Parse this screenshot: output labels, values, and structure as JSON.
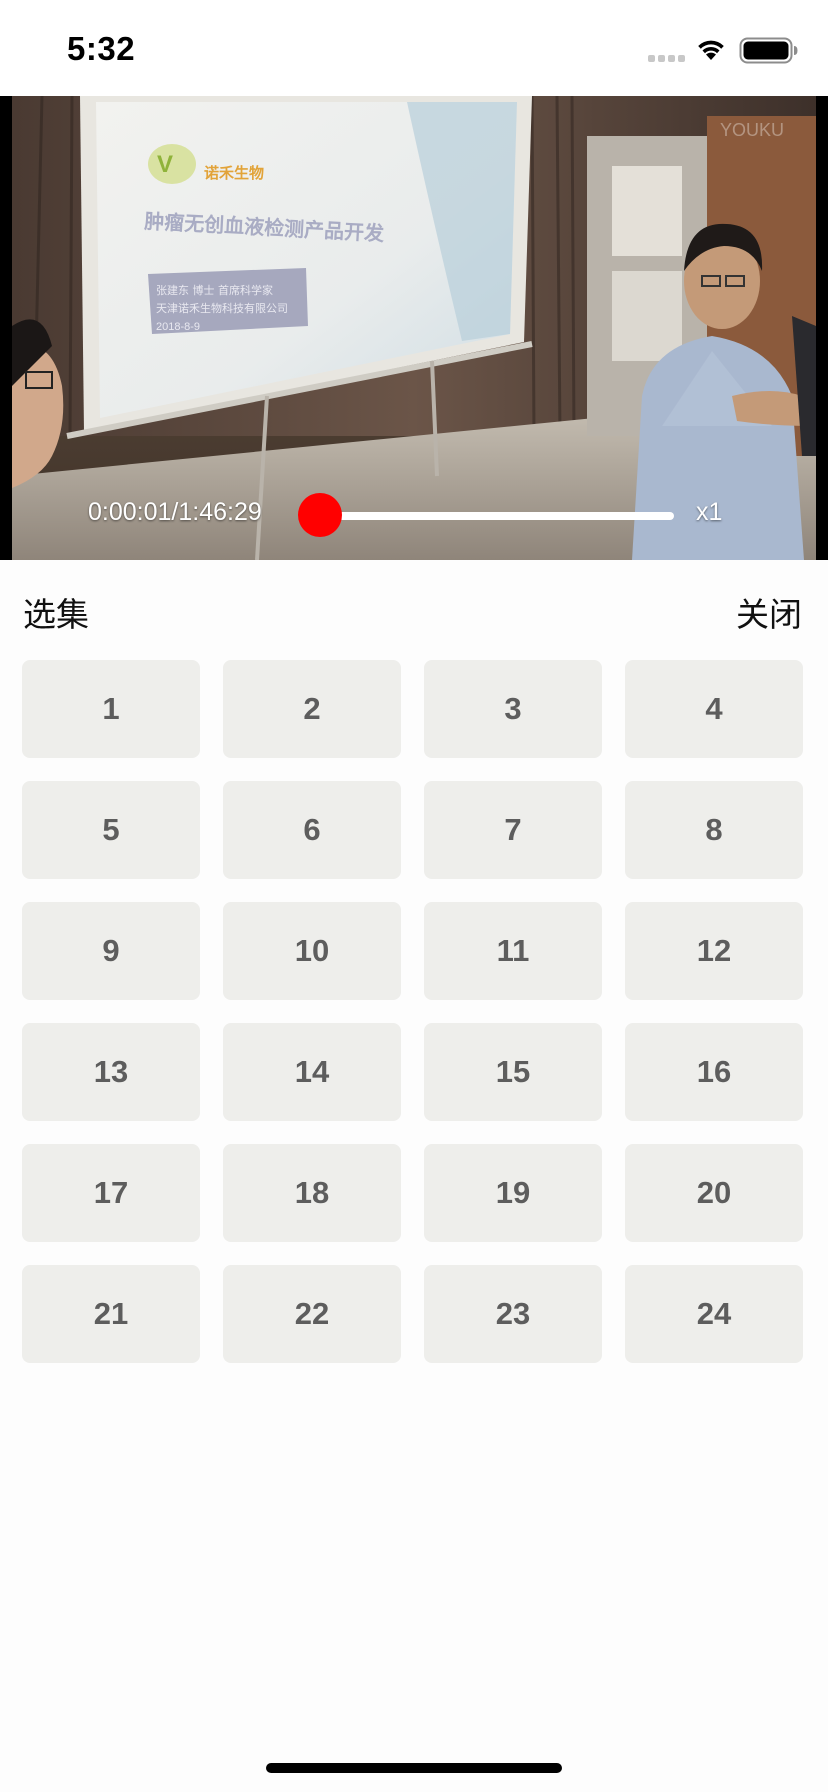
{
  "status_bar": {
    "time": "5:32"
  },
  "player": {
    "current_time": "0:00:01/1:46:29",
    "progress": 0.0,
    "speed": "x1",
    "slide_title": "肿瘤无创血液检测产品开发",
    "slide_author_line1": "张建东  博士  首席科学家",
    "slide_author_line2": "天津诺禾生物科技有限公司",
    "slide_date": "2018-8-9",
    "slide_brand": "诺禾生物",
    "watermark": "YOUKU",
    "colors": {
      "progress_knob": "#ff0000",
      "progress_track": "#ffffff"
    }
  },
  "episode_panel": {
    "title": "选集",
    "close_label": "关闭",
    "episodes": [
      "1",
      "2",
      "3",
      "4",
      "5",
      "6",
      "7",
      "8",
      "9",
      "10",
      "11",
      "12",
      "13",
      "14",
      "15",
      "16",
      "17",
      "18",
      "19",
      "20",
      "21",
      "22",
      "23",
      "24"
    ]
  }
}
